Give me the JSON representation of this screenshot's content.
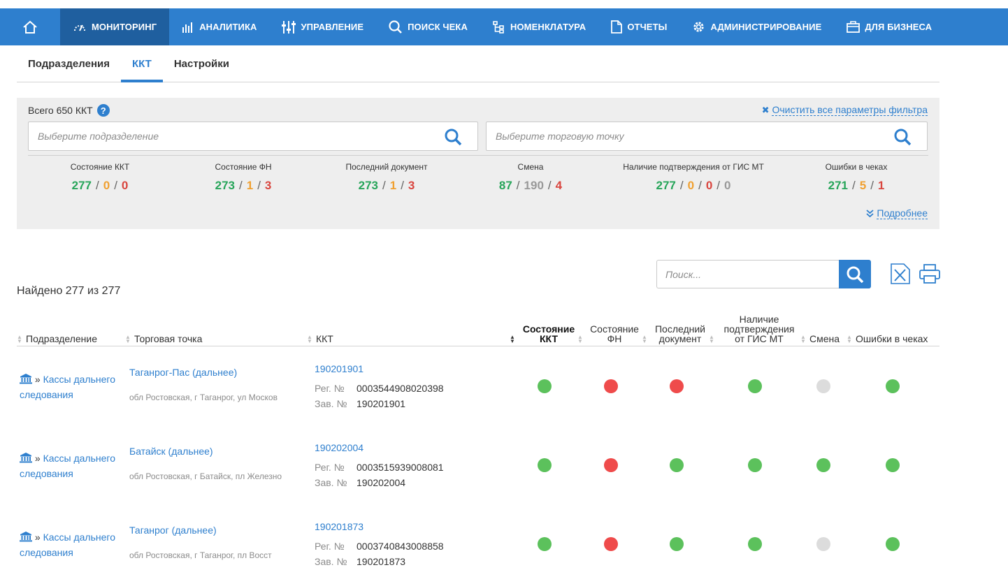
{
  "nav": {
    "items": [
      {
        "label": "МОНИТОРИНГ",
        "icon": "speedometer-icon"
      },
      {
        "label": "АНАЛИТИКА",
        "icon": "bar-chart-icon"
      },
      {
        "label": "УПРАВЛЕНИЕ",
        "icon": "sliders-icon"
      },
      {
        "label": "ПОИСК ЧЕКА",
        "icon": "search-icon"
      },
      {
        "label": "НОМЕНКЛАТУРА",
        "icon": "hierarchy-icon"
      },
      {
        "label": "ОТЧЕТЫ",
        "icon": "document-icon"
      },
      {
        "label": "АДМИНИСТРИРОВАНИЕ",
        "icon": "gear-icon"
      },
      {
        "label": "ДЛЯ БИЗНЕСА",
        "icon": "briefcase-icon"
      }
    ]
  },
  "subtabs": [
    "Подразделения",
    "ККТ",
    "Настройки"
  ],
  "filter": {
    "total": "Всего 650 ККТ",
    "clear": "Очистить все параметры фильтра",
    "division_placeholder": "Выберите подразделение",
    "store_placeholder": "Выберите торговую точку",
    "more": "Подробнее",
    "stats": [
      {
        "label": "Состояние ККТ",
        "values": [
          "277",
          "0",
          "0"
        ]
      },
      {
        "label": "Состояние ФН",
        "values": [
          "273",
          "1",
          "3"
        ]
      },
      {
        "label": "Последний документ",
        "values": [
          "273",
          "1",
          "3"
        ]
      },
      {
        "label": "Смена",
        "values": [
          "87",
          "190",
          "4"
        ]
      },
      {
        "label": "Наличие подтверждения от ГИС МТ",
        "values": [
          "277",
          "0",
          "0",
          "0"
        ]
      },
      {
        "label": "Ошибки в чеках",
        "values": [
          "271",
          "5",
          "1"
        ]
      }
    ]
  },
  "search": {
    "found": "Найдено 277 из 277",
    "placeholder": "Поиск..."
  },
  "table": {
    "headers": {
      "division": "Подразделение",
      "store": "Торговая точка",
      "kkt": "ККТ",
      "kkt_state": "Состояние ККТ",
      "fn_state": "Состояние ФН",
      "last_doc": "Последний документ",
      "gis": "Наличие подтверждения от ГИС МТ",
      "shift": "Смена",
      "errors": "Ошибки в чеках"
    },
    "reg_label": "Рег. №",
    "serial_label": "Зав. №",
    "rows": [
      {
        "division": "Кассы дальнего следования",
        "store_name": "Таганрог-Пас (дальнее)",
        "store_addr": "обл Ростовская, г Таганрог, ул Москов",
        "kkt": "190201901",
        "reg": "0003544908020398",
        "serial": "190201901",
        "statuses": [
          "green",
          "red",
          "red",
          "green",
          "grey",
          "green"
        ]
      },
      {
        "division": "Кассы дальнего следования",
        "store_name": "Батайск (дальнее)",
        "store_addr": "обл Ростовская, г Батайск, пл Железно",
        "kkt": "190202004",
        "reg": "0003515939008081",
        "serial": "190202004",
        "statuses": [
          "green",
          "red",
          "green",
          "green",
          "green",
          "green"
        ]
      },
      {
        "division": "Кассы дальнего следования",
        "store_name": "Таганрог (дальнее)",
        "store_addr": "обл Ростовская, г Таганрог, пл Восст",
        "kkt": "190201873",
        "reg": "0003740843008858",
        "serial": "190201873",
        "statuses": [
          "green",
          "red",
          "green",
          "green",
          "grey",
          "green"
        ]
      }
    ]
  }
}
